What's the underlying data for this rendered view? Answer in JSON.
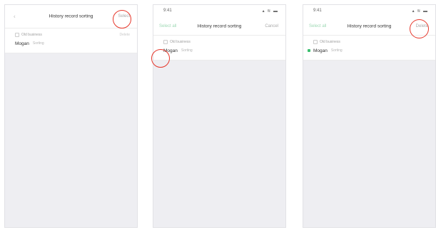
{
  "screens": [
    {
      "nav": {
        "back": "‹",
        "title": "History record sorting",
        "right": "Select"
      },
      "section": {
        "header": "Old business",
        "row": {
          "name": "Mogan",
          "value": "Sorting",
          "meta": "Delete"
        }
      }
    },
    {
      "status": {
        "time": "9:41",
        "icons": "▴ ≋ ▬"
      },
      "nav": {
        "left": "Select all",
        "title": "History record sorting",
        "right": "Cancel"
      },
      "section": {
        "header": "Old business",
        "row": {
          "name": "Mogan",
          "value": "Sorting"
        }
      }
    },
    {
      "status": {
        "time": "9:41",
        "icons": "▴ ≋ ▬"
      },
      "nav": {
        "left": "Select all",
        "title": "History record sorting",
        "right": "Delete"
      },
      "section": {
        "header": "Old business",
        "row": {
          "name": "Mogan",
          "value": "Sorting"
        }
      }
    }
  ],
  "colors": {
    "highlight": "#e6372b",
    "accent": "#3bbf6f"
  }
}
